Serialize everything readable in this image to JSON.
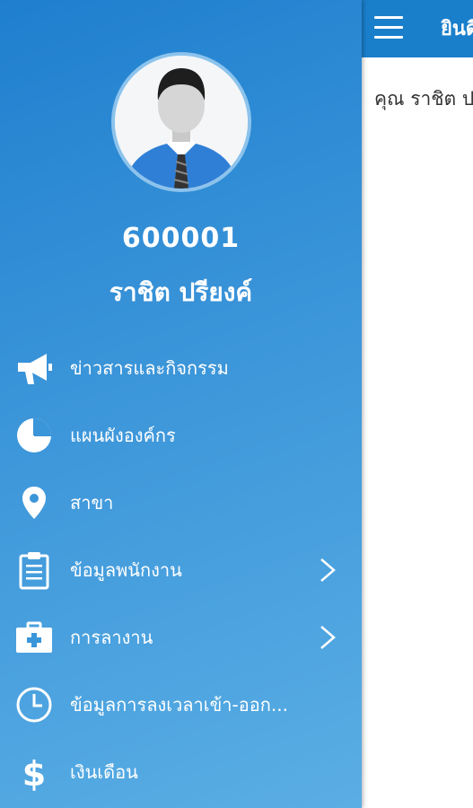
{
  "drawer": {
    "user_id": "600001",
    "user_name": "ราชิต ปรียงค์",
    "items": [
      {
        "label": "ข่าวสารและกิจกรรม",
        "icon": "megaphone-icon",
        "has_chevron": false
      },
      {
        "label": "แผนผังองค์กร",
        "icon": "pie-chart-icon",
        "has_chevron": false
      },
      {
        "label": "สาขา",
        "icon": "map-pin-icon",
        "has_chevron": false
      },
      {
        "label": "ข้อมูลพนักงาน",
        "icon": "clipboard-icon",
        "has_chevron": true
      },
      {
        "label": "การลางาน",
        "icon": "medical-kit-icon",
        "has_chevron": true
      },
      {
        "label": "ข้อมูลการลงเวลาเข้า-ออก...",
        "icon": "clock-icon",
        "has_chevron": false
      },
      {
        "label": "เงินเดือน",
        "icon": "dollar-icon",
        "has_chevron": false
      }
    ]
  },
  "topbar": {
    "title": "ยินดีต้อนรับ",
    "menu_icon": "hamburger-icon"
  },
  "content": {
    "greeting": "คุณ ราชิต ปรียงค์"
  },
  "colors": {
    "drawer_gradient_start": "#1f7fcf",
    "drawer_gradient_end": "#5aaee4",
    "topbar": "#1a7fcb",
    "text_on_blue": "#ffffff"
  }
}
